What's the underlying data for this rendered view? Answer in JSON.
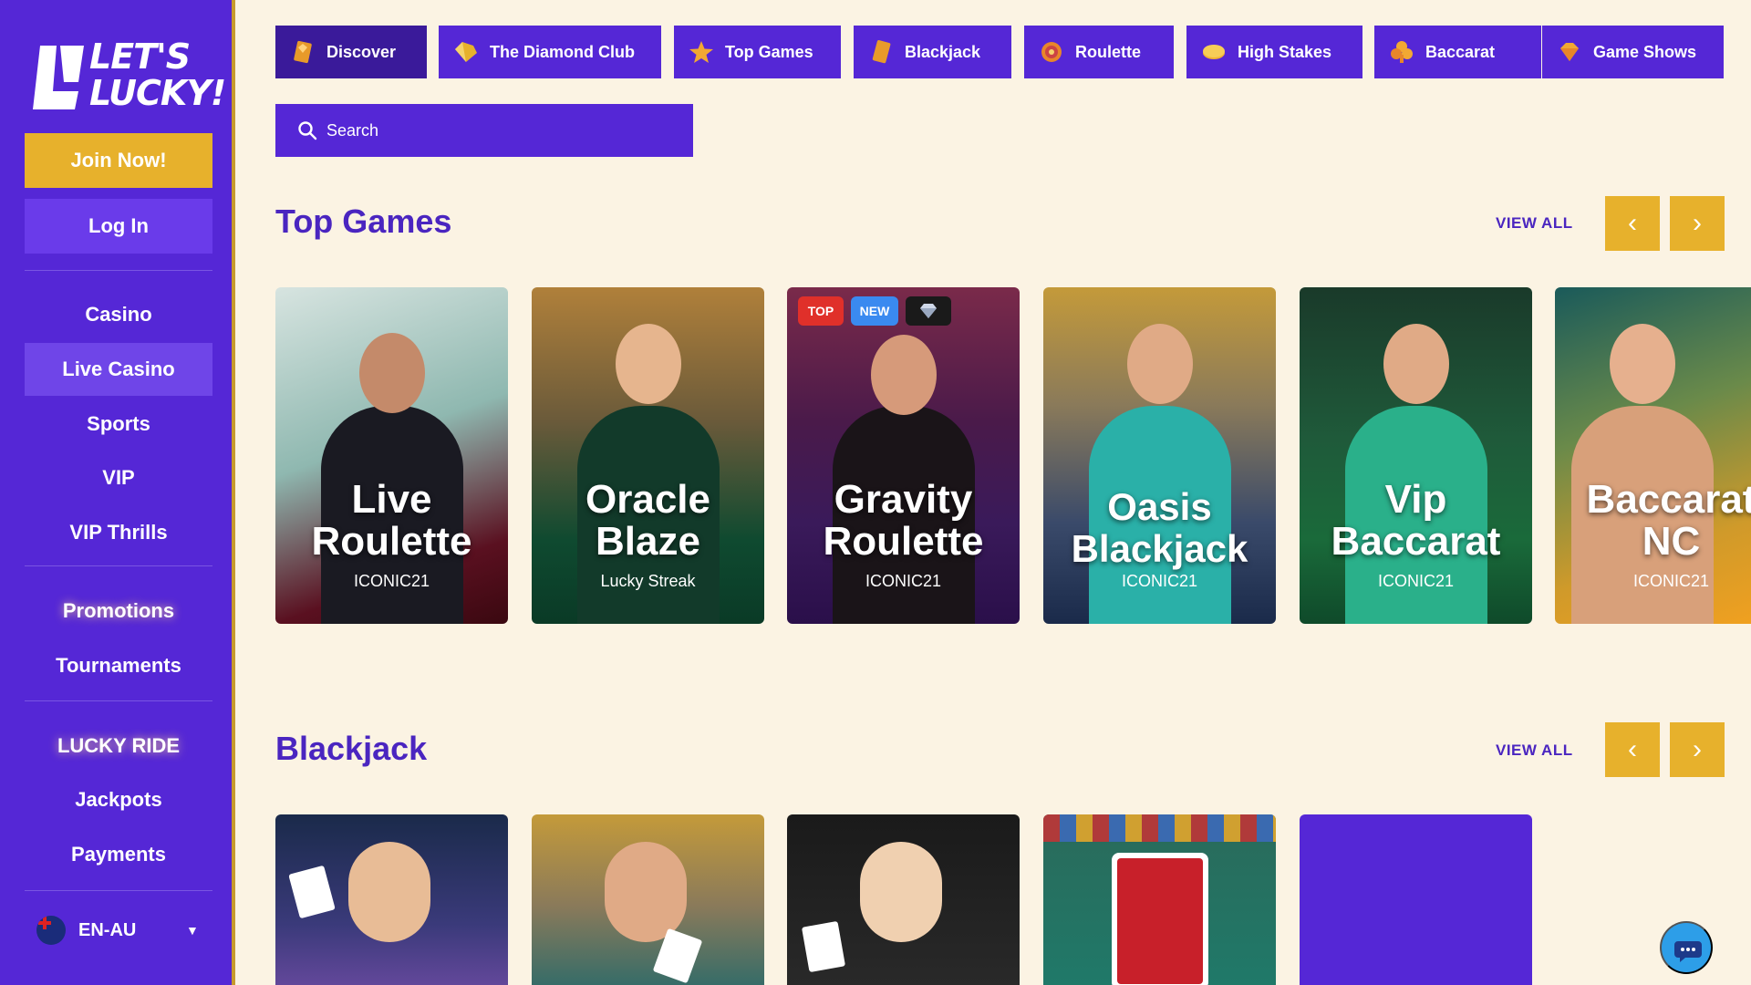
{
  "brand": {
    "logo_text": "LET'S LUCKY!"
  },
  "sidebar": {
    "join_label": "Join Now!",
    "login_label": "Log In",
    "items": [
      {
        "label": "Casino"
      },
      {
        "label": "Live Casino"
      },
      {
        "label": "Sports"
      },
      {
        "label": "VIP"
      },
      {
        "label": "VIP Thrills"
      },
      {
        "label": "Promotions"
      },
      {
        "label": "Tournaments"
      },
      {
        "label": "LUCKY RIDE"
      },
      {
        "label": "Jackpots"
      },
      {
        "label": "Payments"
      }
    ],
    "language": "EN-AU"
  },
  "tabs": [
    {
      "label": "Discover",
      "icon": "diamond-card-icon"
    },
    {
      "label": "The Diamond Club",
      "icon": "gold-diamond-icon"
    },
    {
      "label": "Top Games",
      "icon": "star-icon"
    },
    {
      "label": "Blackjack",
      "icon": "card-icon"
    },
    {
      "label": "Roulette",
      "icon": "roulette-icon"
    },
    {
      "label": "High Stakes",
      "icon": "chip-icon"
    },
    {
      "label": "Baccarat",
      "icon": "clover-icon"
    },
    {
      "label": "Game Shows",
      "icon": "gem-icon"
    }
  ],
  "search": {
    "placeholder": "Search"
  },
  "sections": [
    {
      "title": "Top Games",
      "view_all": "VIEW ALL",
      "games": [
        {
          "name": "Live Roulette",
          "provider": "ICONIC21"
        },
        {
          "name": "Oracle Blaze",
          "provider": "Lucky Streak"
        },
        {
          "name": "Gravity Roulette",
          "provider": "ICONIC21",
          "badges": [
            "TOP",
            "NEW"
          ]
        },
        {
          "name": "Oasis Blackjack",
          "provider": "ICONIC21"
        },
        {
          "name": "Vip Baccarat",
          "provider": "ICONIC21"
        },
        {
          "name": "Baccarat NC",
          "provider": "ICONIC21"
        }
      ]
    },
    {
      "title": "Blackjack",
      "view_all": "VIEW ALL"
    }
  ],
  "colors": {
    "sidebar": "#5527d6",
    "accent": "#e7b12c",
    "background": "#fbf3e3",
    "heading": "#4a25c0"
  }
}
